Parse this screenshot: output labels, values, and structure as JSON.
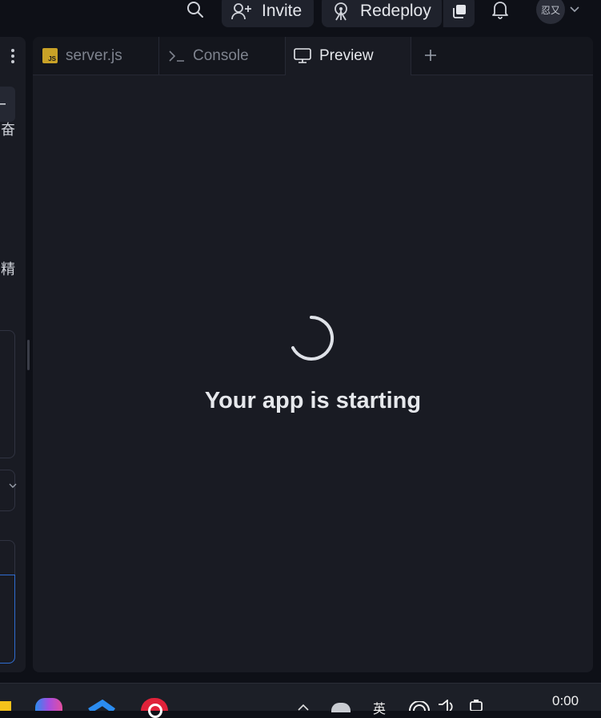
{
  "topbar": {
    "invite_label": "Invite",
    "redeploy_label": "Redeploy",
    "avatar_text": "忍又"
  },
  "sidebar": {
    "glyph_1": "奋",
    "glyph_2": "精"
  },
  "tabs": [
    {
      "label": "server.js",
      "icon": "js-file-icon",
      "active": false
    },
    {
      "label": "Console",
      "icon": "terminal-icon",
      "active": false
    },
    {
      "label": "Preview",
      "icon": "monitor-icon",
      "active": true
    }
  ],
  "preview": {
    "status_text": "Your app is starting"
  },
  "taskbar": {
    "clock": "0:00",
    "ime_indicator": "英"
  },
  "colors": {
    "accent_blue": "#2f6cd0",
    "js_badge": "#c9a227",
    "panel_bg": "#191b23",
    "app_bg": "#0e1017"
  }
}
